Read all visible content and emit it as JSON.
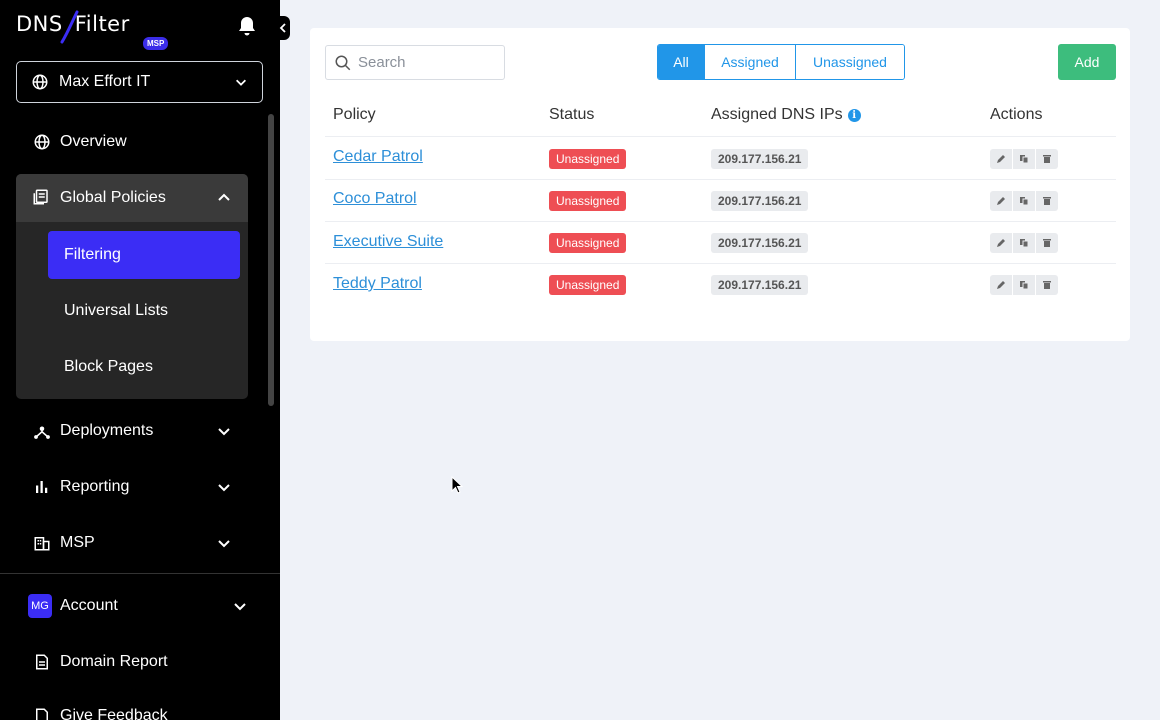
{
  "brand": {
    "logo_text_left": "DNS",
    "logo_text_right": "Filter",
    "badge": "MSP"
  },
  "org_select": {
    "value": "Max Effort IT"
  },
  "sidebar": {
    "overview": "Overview",
    "global_policies": {
      "label": "Global Policies",
      "items": [
        "Filtering",
        "Universal Lists",
        "Block Pages"
      ],
      "active": "Filtering"
    },
    "deployments": "Deployments",
    "reporting": "Reporting",
    "msp": "MSP",
    "account": {
      "label": "Account",
      "avatar": "MG"
    },
    "domain_report": "Domain Report",
    "give_feedback": "Give Feedback"
  },
  "toolbar": {
    "search_placeholder": "Search",
    "filters": [
      "All",
      "Assigned",
      "Unassigned"
    ],
    "active_filter": "All",
    "add_label": "Add"
  },
  "table": {
    "headers": {
      "policy": "Policy",
      "status": "Status",
      "assigned_ips": "Assigned DNS IPs",
      "actions": "Actions"
    },
    "rows": [
      {
        "policy": "Cedar Patrol",
        "status": "Unassigned",
        "ip": "209.177.156.21"
      },
      {
        "policy": "Coco Patrol",
        "status": "Unassigned",
        "ip": "209.177.156.21"
      },
      {
        "policy": "Executive Suite",
        "status": "Unassigned",
        "ip": "209.177.156.21"
      },
      {
        "policy": "Teddy Patrol",
        "status": "Unassigned",
        "ip": "209.177.156.21"
      }
    ]
  },
  "colors": {
    "sidebar_bg": "#000000",
    "active_nav": "#3b2df5",
    "primary_blue": "#2196e8",
    "add_green": "#3dbd7d",
    "unassigned_red": "#ee4e54",
    "page_bg": "#eff2f8"
  },
  "icons": [
    "bell-icon",
    "globe-icon",
    "policies-icon",
    "deployments-icon",
    "reporting-icon",
    "building-icon",
    "document-icon",
    "search-icon",
    "info-icon",
    "edit-icon",
    "copy-icon",
    "trash-icon"
  ]
}
